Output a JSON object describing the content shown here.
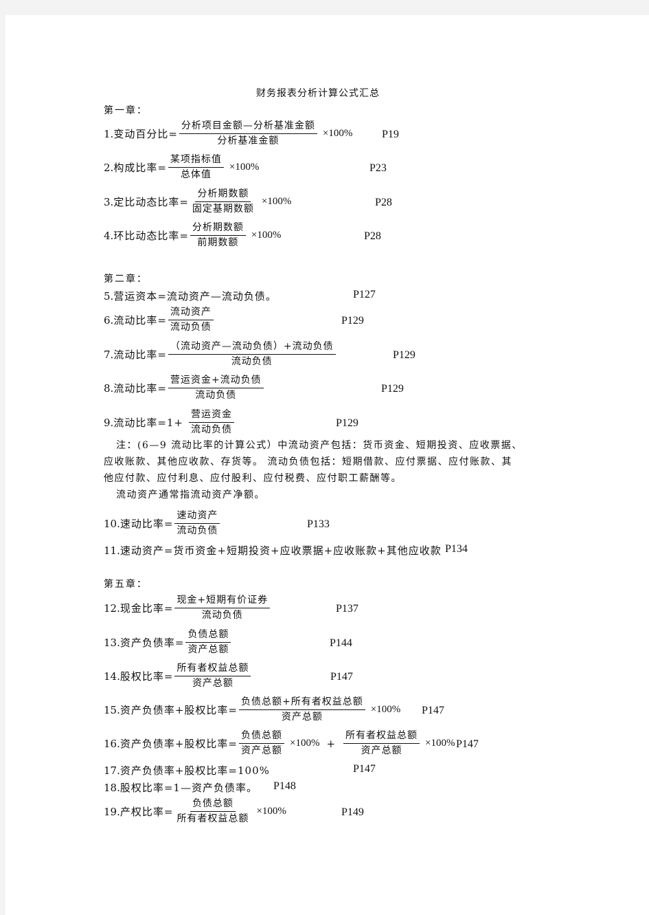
{
  "document": {
    "title": "财务报表分析计算公式汇总",
    "chapters": [
      {
        "label": "第一章："
      },
      {
        "label": "第二章："
      },
      {
        "label": "第五章："
      }
    ],
    "formulas": [
      {
        "no": "1.",
        "name": "变动百分比=",
        "num": "分析项目金额—分析基准金额",
        "den": "分析基准金额",
        "suffix": "×100%",
        "page": "P19"
      },
      {
        "no": "2.",
        "name": "构成比率=",
        "num": "某项指标值",
        "den": "总体值",
        "suffix": "×100%",
        "page": "P23"
      },
      {
        "no": "3.",
        "name": "定比动态比率=",
        "num": "分析期数额",
        "den": "固定基期数额",
        "suffix": "×100%",
        "page": "P28"
      },
      {
        "no": "4.",
        "name": "环比动态比率=",
        "num": "分析期数额",
        "den": "前期数额",
        "suffix": "×100%",
        "page": "P28"
      },
      {
        "no": "5.",
        "text": "营运资本=流动资产—流动负债。",
        "page": "P127"
      },
      {
        "no": "6.",
        "name": "流动比率=",
        "num": "流动资产",
        "den": "流动负债",
        "page": "P129"
      },
      {
        "no": "7.",
        "name": "流动比率=",
        "num": "（流动资产—流动负债）+流动负债",
        "den": "流动负债",
        "page": "P129"
      },
      {
        "no": "8.",
        "name": "流动比率=",
        "num": "营运资金+流动负债",
        "den": "流动负债",
        "page": "P129"
      },
      {
        "no": "9.",
        "name": "流动比率=1+",
        "num": "营运资金",
        "den": "流动负债",
        "page": "P129"
      },
      {
        "no": "10.",
        "name": "速动比率=",
        "num": "速动资产",
        "den": "流动负债",
        "page": "P133"
      },
      {
        "no": "11.",
        "text": "速动资产=货币资金+短期投资+应收票据+应收账款+其他应收款",
        "page": "P134"
      },
      {
        "no": "12.",
        "name": "现金比率=",
        "num": "现金+短期有价证券",
        "den": "流动负债",
        "page": "P137"
      },
      {
        "no": "13.",
        "name": "资产负债率=",
        "num": "负债总额",
        "den": "资产总额",
        "page": "P144"
      },
      {
        "no": "14.",
        "name": "股权比率=",
        "num": "所有者权益总额",
        "den": "资产总额",
        "page": "P147"
      },
      {
        "no": "15.",
        "name": "资产负债率+股权比率=",
        "num": "负债总额+所有者权益总额",
        "den": "资产总额",
        "suffix": "×100%",
        "page": "P147"
      },
      {
        "no": "16.",
        "name": "资产负债率+股权比率=",
        "num": "负债总额",
        "den": "资产总额",
        "suffix": "×100%",
        "plus": "+",
        "num2": "所有者权益总额",
        "den2": "资产总额",
        "suffix2": "×100%",
        "page": "P147"
      },
      {
        "no": "17.",
        "text": "资产负债率+股权比率=100%",
        "page": "P147"
      },
      {
        "no": "18.",
        "text": "股权比率=1—资产负债率。",
        "page": "P148"
      },
      {
        "no": "19.",
        "name": "产权比率=",
        "num": "负债总额",
        "den": "所有者权益总额",
        "suffix": "×100%",
        "page": "P149"
      }
    ],
    "note": {
      "lines": [
        "注：(6—9 流动比率的计算公式）中流动资产包括：货币资金、短期投资、应收票据、",
        "应收账款、其他应收款、存货等。 流动负债包括：短期借款、应付票据、应付账款、其",
        "他应付款、应付利息、应付股利、应付税费、应付职工薪酬等。",
        "流动资产通常指流动资产净额。"
      ]
    }
  }
}
